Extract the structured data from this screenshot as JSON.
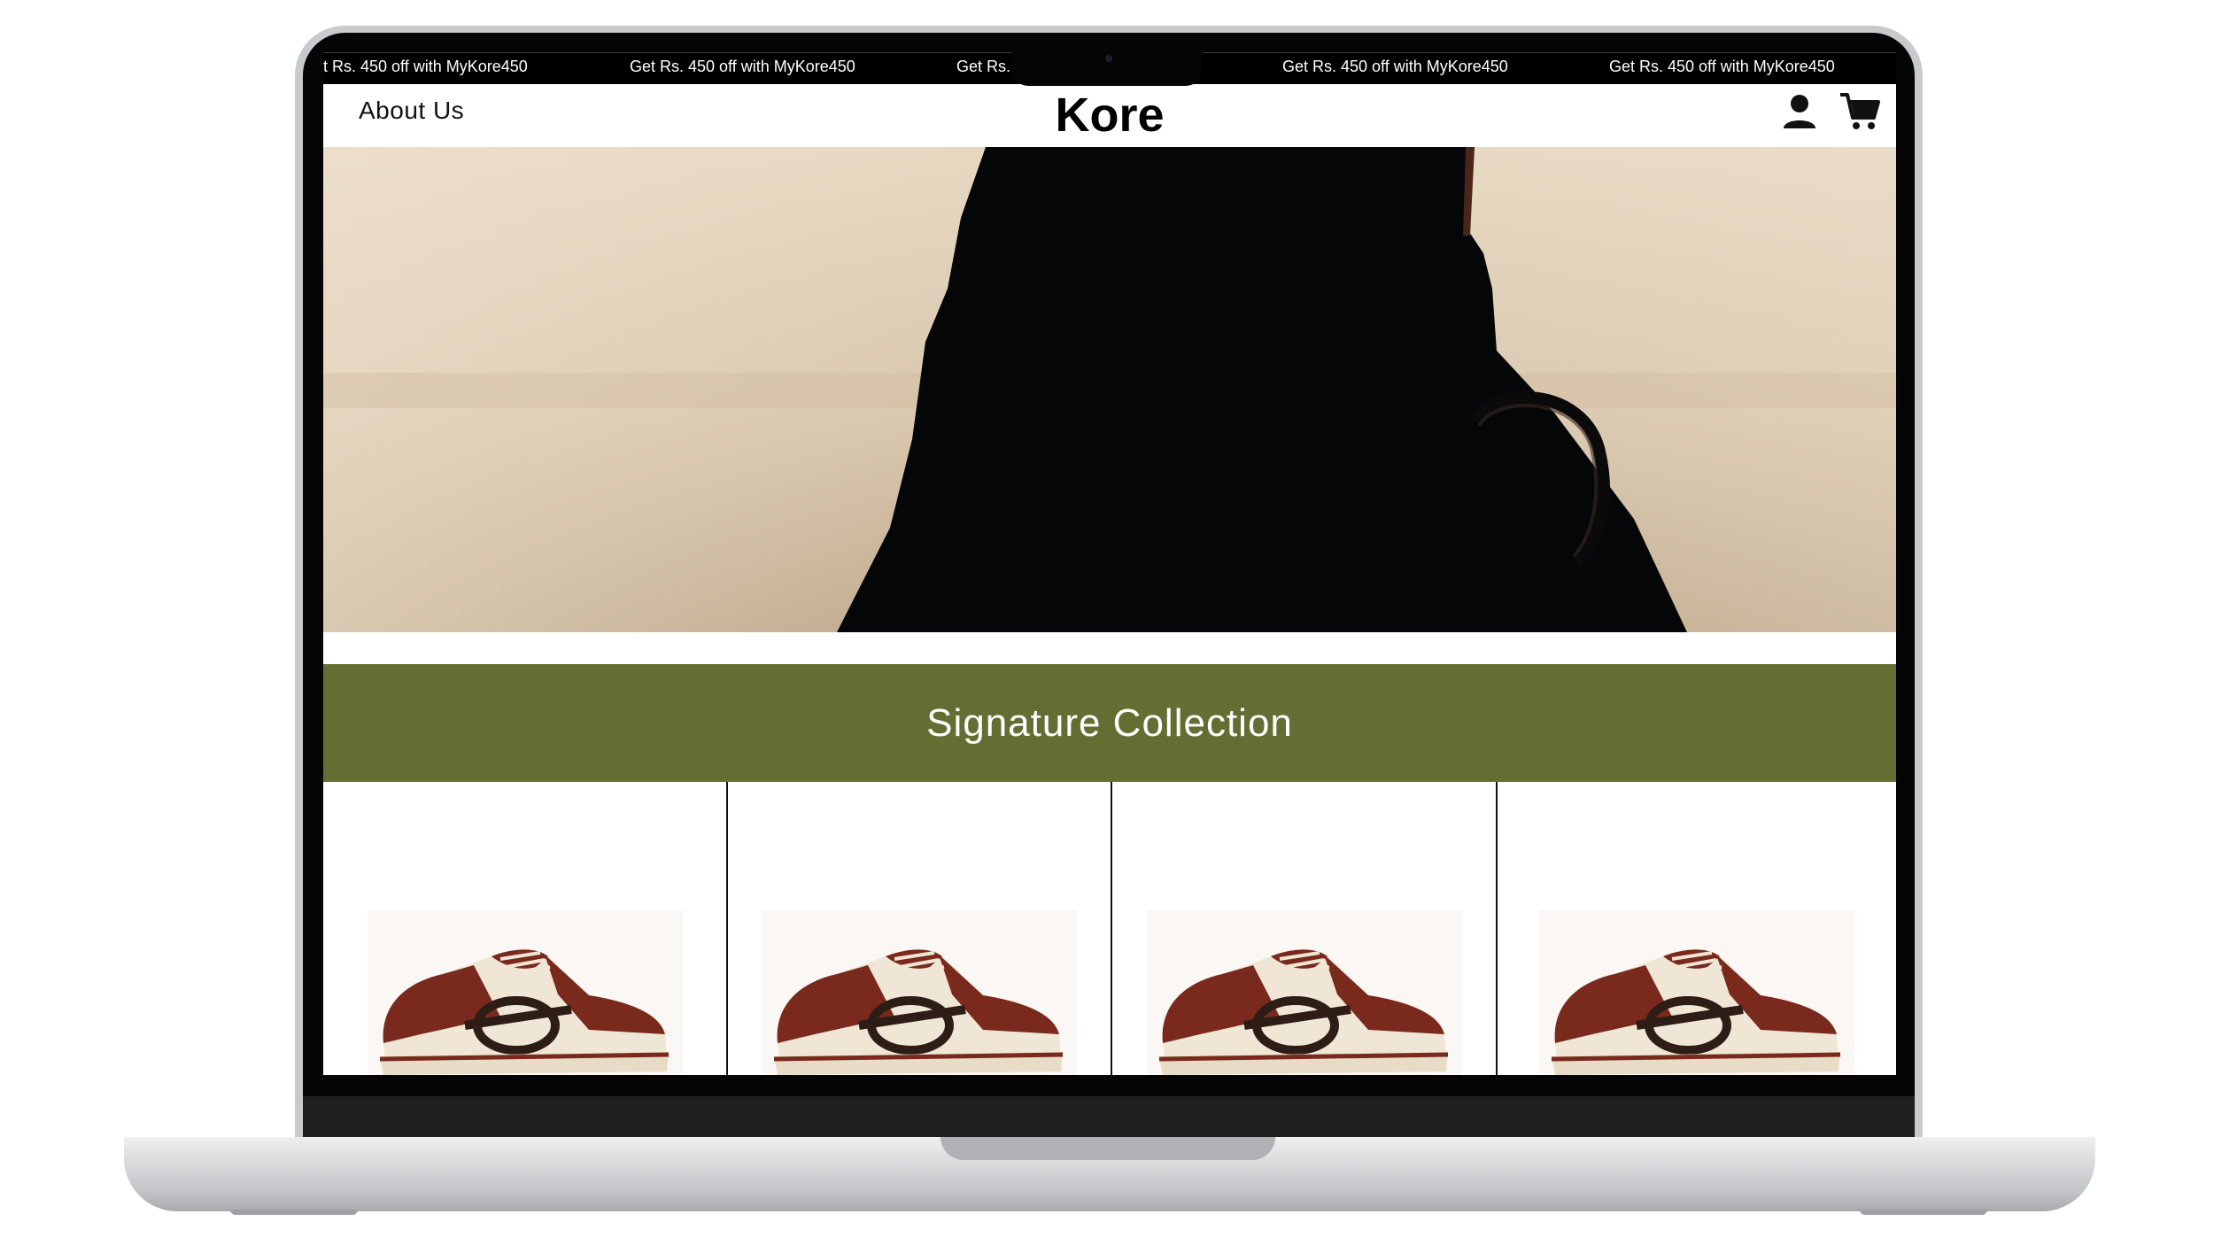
{
  "promo": {
    "items": [
      "t Rs. 450 off with MyKore450",
      "Get Rs. 450 off with MyKore450",
      "Get Rs.",
      "Get Rs. 450 off with MyKore450",
      "Get Rs. 450 off with MyKore450"
    ]
  },
  "header": {
    "nav_about": "About Us",
    "logo": "Kore",
    "account_icon": "user-icon",
    "cart_icon": "cart-icon"
  },
  "hero": {
    "alt": "hero-image"
  },
  "section": {
    "title": "Signature Collection"
  },
  "products": [
    {
      "image": "sneaker-image"
    },
    {
      "image": "sneaker-image"
    },
    {
      "image": "sneaker-image"
    },
    {
      "image": "sneaker-image"
    }
  ],
  "colors": {
    "banner": "#646e33",
    "promo_bg": "#000000",
    "sneaker_red": "#7a2a1d",
    "sneaker_cream": "#efe6d6"
  }
}
